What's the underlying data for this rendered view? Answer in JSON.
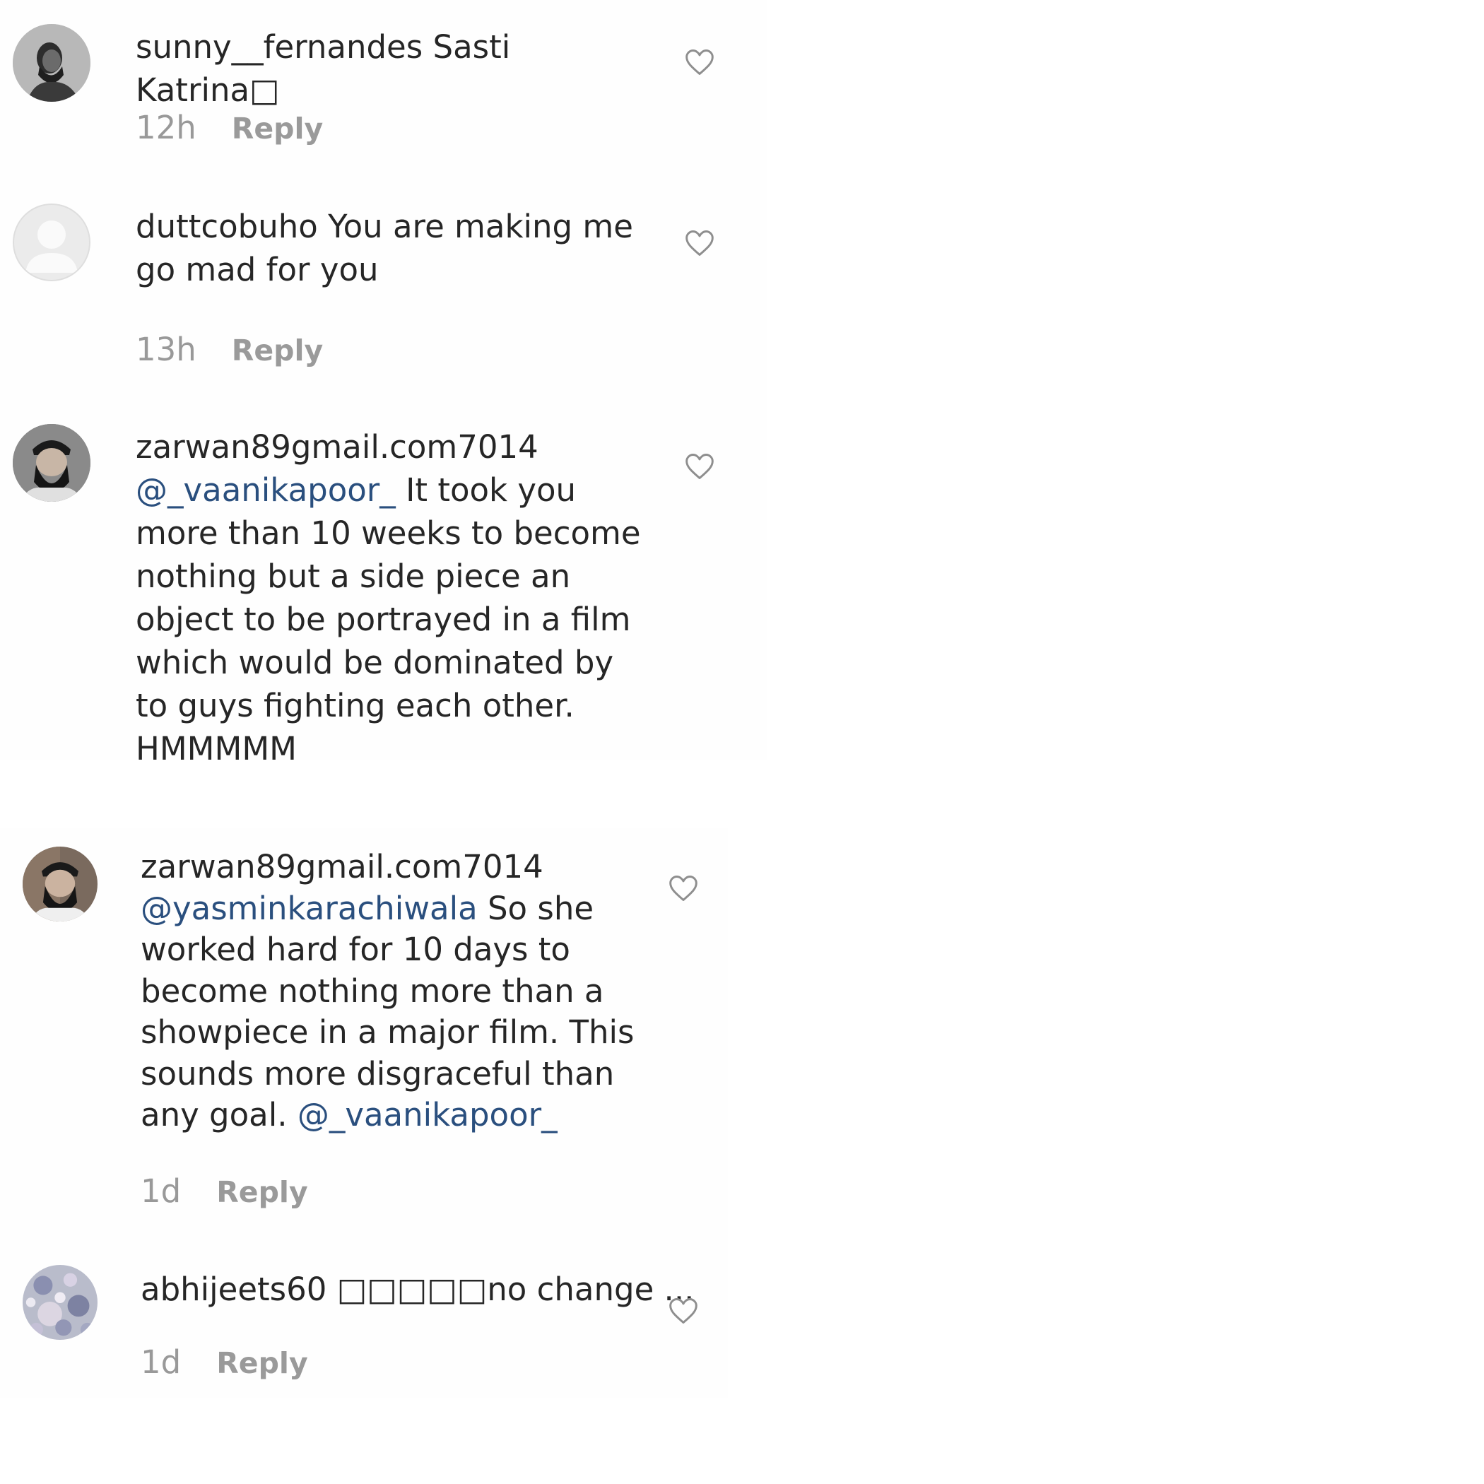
{
  "comments": [
    {
      "username": "sunny__fernandes",
      "text": "Sasti Katrina□",
      "time": "12h",
      "reply_label": "Reply",
      "avatar_icon": "profile-photo-man-beard"
    },
    {
      "username": "duttcobuho",
      "text": "You are making me go mad for you",
      "time": "13h",
      "reply_label": "Reply",
      "avatar_icon": "default-avatar-icon"
    },
    {
      "username": "zarwan89gmail.com7014",
      "mention": "@_vaanikapoor_",
      "text": "It took you more than 10 weeks to become nothing but a side piece an object to be portrayed in a film which would be dominated by to guys fighting each other. HMMMMM",
      "avatar_icon": "profile-photo-man-beard-cap"
    },
    {
      "username": "zarwan89gmail.com7014",
      "mention": "@yasminkarachiwala",
      "text": "So she worked hard for 10 days to become nothing more than a showpiece in a major film. This sounds more disgraceful than any goal.",
      "mention_end": "@_vaanikapoor_",
      "time": "1d",
      "reply_label": "Reply",
      "avatar_icon": "profile-photo-man-beard-cap"
    },
    {
      "username": "abhijeets60",
      "text": "□□□□□no change ...",
      "time": "1d",
      "reply_label": "Reply",
      "avatar_icon": "profile-photo-floral-pattern"
    }
  ],
  "icons": {
    "like": "heart-outline-icon"
  },
  "colors": {
    "text": "#262626",
    "mention": "#2a4f7e",
    "meta": "#999999",
    "background": "#fefefe"
  }
}
